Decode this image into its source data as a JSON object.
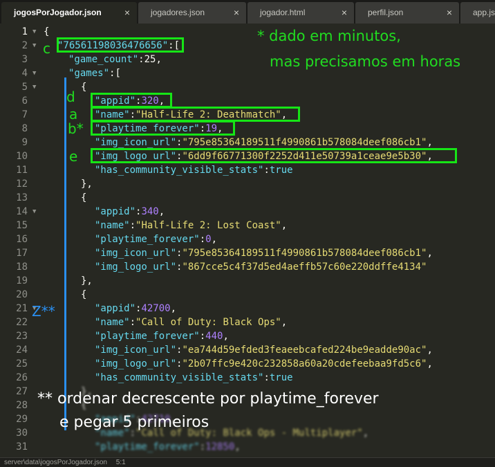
{
  "tabs": [
    {
      "label": "jogosPorJogador.json",
      "close": "×",
      "active": true
    },
    {
      "label": "jogadores.json",
      "close": "×",
      "active": false
    },
    {
      "label": "jogador.html",
      "close": "×",
      "active": false
    },
    {
      "label": "perfil.json",
      "close": "×",
      "active": false
    },
    {
      "label": "app.js",
      "close": "",
      "active": false
    }
  ],
  "line_numbers": [
    "1",
    "2",
    "3",
    "4",
    "5",
    "6",
    "7",
    "8",
    "9",
    "10",
    "11",
    "12",
    "13",
    "14",
    "15",
    "16",
    "17",
    "18",
    "19",
    "20",
    "21",
    "22",
    "23",
    "24",
    "25",
    "26",
    "27",
    "28",
    "29",
    "30",
    "31"
  ],
  "code": {
    "l1": "{",
    "l2_key": "\"76561198036476656\"",
    "l2_rest": ":[",
    "l3_key": "\"game_count\"",
    "l3_rest": ":25,",
    "l4_key": "\"games\"",
    "l4_rest": ":[",
    "l5": "{",
    "g1": {
      "appid_key": "\"appid\"",
      "appid_val": "320",
      "name_key": "\"name\"",
      "name_val": "\"Half-Life 2: Deathmatch\"",
      "play_key": "\"playtime_forever\"",
      "play_val": "19",
      "icon_key": "\"img_icon_url\"",
      "icon_val": "\"795e85364189511f4990861b578084deef086cb1\"",
      "logo_key": "\"img_logo_url\"",
      "logo_val": "\"6dd9f66771300f2252d411e50739a1ceae9e5b30\"",
      "stats_key": "\"has_community_visible_stats\"",
      "stats_val": "true"
    },
    "close_obj": "},",
    "open_obj": "{",
    "g2": {
      "appid_key": "\"appid\"",
      "appid_val": "340",
      "name_key": "\"name\"",
      "name_val": "\"Half-Life 2: Lost Coast\"",
      "play_key": "\"playtime_forever\"",
      "play_val": "0",
      "icon_key": "\"img_icon_url\"",
      "icon_val": "\"795e85364189511f4990861b578084deef086cb1\"",
      "logo_key": "\"img_logo_url\"",
      "logo_val": "\"867cce5c4f37d5ed4aeffb57c60e220ddffe4134\""
    },
    "g3": {
      "appid_key": "\"appid\"",
      "appid_val": "42700",
      "name_key": "\"name\"",
      "name_val": "\"Call of Duty: Black Ops\"",
      "play_key": "\"playtime_forever\"",
      "play_val": "440",
      "icon_key": "\"img_icon_url\"",
      "icon_val": "\"ea744d59efded3feaeebcafed224be9eadde90ac\"",
      "logo_key": "\"img_logo_url\"",
      "logo_val": "\"2b07ffc9e420c232858a60a20cdefeebaa9fd5c6\"",
      "stats_key": "\"has_community_visible_stats\"",
      "stats_val": "true"
    },
    "g4": {
      "appid_key": "\"appid\"",
      "appid_val": "42710",
      "name_key": "\"name\"",
      "name_val": "\"Call of Duty: Black Ops - Multiplayer\"",
      "play_key": "\"playtime_forever\"",
      "play_val": "12850"
    }
  },
  "annotations": {
    "note_title": "* dado em minutos,",
    "note_sub": "mas precisamos em horas",
    "letter_c": "c",
    "letter_d": "d",
    "letter_a": "a",
    "letter_b": "b*",
    "letter_e": "e",
    "letter_z": "Z**",
    "bottom_line1": "** ordenar decrescente por playtime_forever",
    "bottom_line2": "e pegar 5 primeiros"
  },
  "statusbar": {
    "path": "server\\data\\jogosPorJogador.json",
    "extra": "5:1"
  },
  "colors": {
    "background": "#272822",
    "key": "#66d9ef",
    "string": "#e6db74",
    "number": "#ae81ff",
    "annotation_green": "#16e516",
    "annotation_blue": "#2a8ff0"
  }
}
